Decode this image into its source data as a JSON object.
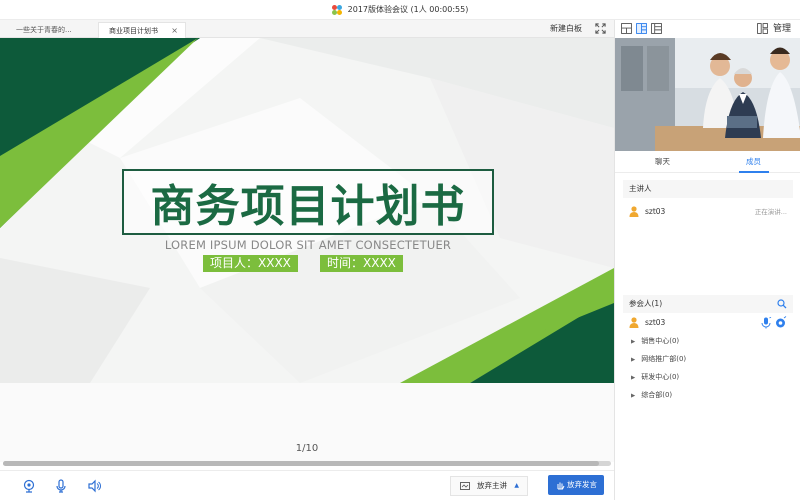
{
  "window": {
    "title": "2017版体验会议 (1人 00:00:55)"
  },
  "tabs": [
    {
      "label": "一些关于青春的...",
      "active": false
    },
    {
      "label": "商业项目计划书",
      "active": true,
      "close": "×"
    }
  ],
  "toolbar": {
    "new_whiteboard": "新建白板"
  },
  "slide": {
    "title": "商务项目计划书",
    "subtitle": "LOREM IPSUM DOLOR SIT AMET CONSECTETUER",
    "project_person": "项目人：XXXX",
    "time": "时间：XXXX"
  },
  "pagination": {
    "label": "1/10",
    "scroll_progress": 0.98
  },
  "bottom_bar": {
    "give_up_host": "放弃主讲",
    "give_up_speech": "放弃发言"
  },
  "right_panel": {
    "manage": "管理",
    "tabs": [
      {
        "label": "聊天",
        "active": false
      },
      {
        "label": "成员",
        "active": true
      }
    ],
    "presenter_section": "主讲人",
    "presenter": {
      "name": "szt03",
      "status": "正在演讲..."
    },
    "attendees_section": "参会人(1)",
    "attendee": {
      "name": "szt03"
    },
    "groups": [
      "销售中心(0)",
      "网络推广部(0)",
      "研发中心(0)",
      "综合部(0)"
    ]
  },
  "colors": {
    "accent": "#2f80ed",
    "slide_green_dark": "#0d5a3a",
    "slide_green_light": "#7cbe3c",
    "presenter_icon": "#f0a830"
  }
}
